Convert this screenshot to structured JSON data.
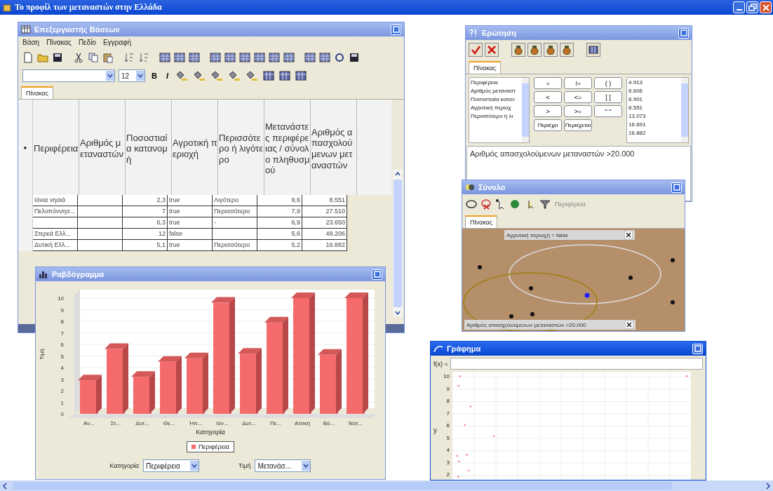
{
  "app": {
    "title": "Το προφίλ των μεταναστών στην Ελλάδα"
  },
  "database_window": {
    "title": "Επεξεργαστής Βάσεων",
    "menu": [
      "Βάση",
      "Πίνακας",
      "Πεδίο",
      "Εγγραφή"
    ],
    "font_size": "12",
    "format_buttons": [
      "B",
      "I"
    ],
    "tabs": [
      {
        "label": "Πίνακας",
        "selected": true
      }
    ],
    "row_marker": "●",
    "columns": [
      "Περιφέρεια",
      "Αριθμός μεταναστών",
      "Ποσοστιαία κατανομή",
      "Αγροτική περιοχή",
      "Περισσότερο ή λιγότερο",
      "Μετανάστες περιφέρειας / σύνολο πληθυσμού",
      "Αριθμός απασχολούμενων μεταναστών"
    ],
    "rows": [
      [
        "Ιόνια νησιά",
        "",
        "2,3",
        "true",
        "Λιγότερο",
        "9,6",
        "8.551"
      ],
      [
        "Πελοπόννησ...",
        "",
        "7",
        "true",
        "Περισσότερο",
        "7,9",
        "27.510"
      ],
      [
        "",
        "",
        "6,3",
        "true",
        "-",
        "6,9",
        "23.650"
      ],
      [
        "Στερεά Ελλ...",
        "",
        "12",
        "false",
        "",
        "5,6",
        "49.206"
      ],
      [
        "Δυτική Ελλ...",
        "",
        "5,1",
        "true",
        "Περισσότερο",
        "5,2",
        "16.882"
      ]
    ]
  },
  "bar_chart_window": {
    "title": "Ραβδόγραμμα",
    "chart_data": {
      "type": "bar",
      "xlabel": "Κατηγορία",
      "ylabel": "Τιμή",
      "categories": [
        "Αν...",
        "Στ...",
        "Δυτ...",
        "Θε...",
        "Ήπ...",
        "Ιόν...",
        "Δυτ...",
        "Πε...",
        "Αττική",
        "Βό...",
        "Νότ..."
      ],
      "series": [
        {
          "name": "Περιφέρεια",
          "color": "#f56b6b",
          "values": [
            2.9,
            5.6,
            3.2,
            4.5,
            4.8,
            9.6,
            5.2,
            7.9,
            10,
            5.1,
            10
          ]
        }
      ],
      "ylim": [
        0,
        10
      ],
      "grid": true,
      "yticks": [
        0,
        1,
        2,
        3,
        4,
        5,
        6,
        7,
        8,
        9,
        10
      ]
    },
    "category_label": "Κατηγορία",
    "category_value": "Περιφέρεια",
    "value_label": "Τιμή",
    "value_value": "Μετανάσ..."
  },
  "query_window": {
    "title": "Ερώτηση",
    "tabs": [
      {
        "label": "Πίνακας",
        "selected": true
      }
    ],
    "fields": [
      "Περιφέρεια",
      "Αριθμός μεταναστ",
      "Ποσοστιαία καταν",
      "Αγροτική περιοχ",
      "Περισσότερο ή λι"
    ],
    "operators": [
      "=",
      "!=",
      "( )",
      "<",
      "<=",
      "[ ]",
      ">",
      ">=",
      "\" \"",
      "Περιέχει",
      "Περιέχεται"
    ],
    "values": [
      "4.913",
      "6.606",
      "6.901",
      "8.551",
      "13.073",
      "16.691",
      "16.882"
    ],
    "query": "Αριθμός απασχολούμενων μεταναστών >20.000"
  },
  "set_window": {
    "title": "Σύνολο",
    "attribute_placeholder": "Περιφέρεια",
    "tabs": [
      {
        "label": "Πίνακας",
        "selected": true
      }
    ],
    "sets": [
      "Αγροτική περιοχή = false",
      "Αριθμός απασχολούμενων μεταναστών >20.000"
    ]
  },
  "graph_window": {
    "title": "Γράφημα",
    "active": true,
    "function_label": "f(x) =",
    "y_label": "y",
    "y_ticks": [
      "10",
      "9",
      "8",
      "7",
      "6",
      "5",
      "4",
      "3",
      "2"
    ]
  }
}
